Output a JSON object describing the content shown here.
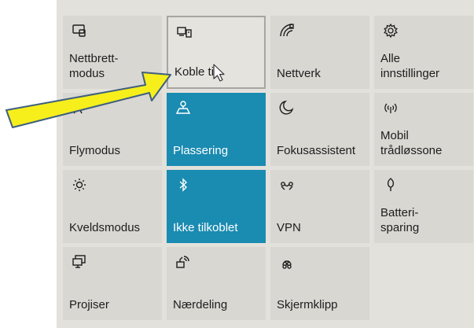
{
  "tiles": [
    {
      "label": "Nettbrett-\nmodus",
      "icon": "tablet-mode-icon",
      "state": "off"
    },
    {
      "label": "Koble til",
      "icon": "connect-icon",
      "state": "hover"
    },
    {
      "label": "Nettverk",
      "icon": "network-icon",
      "state": "off"
    },
    {
      "label": "Alle\ninnstillinger",
      "icon": "gear-icon",
      "state": "off"
    },
    {
      "label": "Flymodus",
      "icon": "airplane-icon",
      "state": "off"
    },
    {
      "label": "Plassering",
      "icon": "location-icon",
      "state": "on"
    },
    {
      "label": "Fokusassistent",
      "icon": "moon-icon",
      "state": "off"
    },
    {
      "label": "Mobil\ntrådløssone",
      "icon": "hotspot-icon",
      "state": "off"
    },
    {
      "label": "Kveldsmodus",
      "icon": "brightness-icon",
      "state": "off"
    },
    {
      "label": "Ikke tilkoblet",
      "icon": "bluetooth-icon",
      "state": "on"
    },
    {
      "label": "VPN",
      "icon": "vpn-icon",
      "state": "off"
    },
    {
      "label": "Batteri-\nsparing",
      "icon": "battery-saver-icon",
      "state": "off"
    },
    {
      "label": "Projiser",
      "icon": "project-icon",
      "state": "off"
    },
    {
      "label": "Nærdeling",
      "icon": "nearby-share-icon",
      "state": "off"
    },
    {
      "label": "Skjermklipp",
      "icon": "screen-snip-icon",
      "state": "off"
    }
  ],
  "colors": {
    "accent": "#1a8bb1",
    "tile": "#d9d7d2",
    "arrow_fill": "#f6ef1c"
  }
}
